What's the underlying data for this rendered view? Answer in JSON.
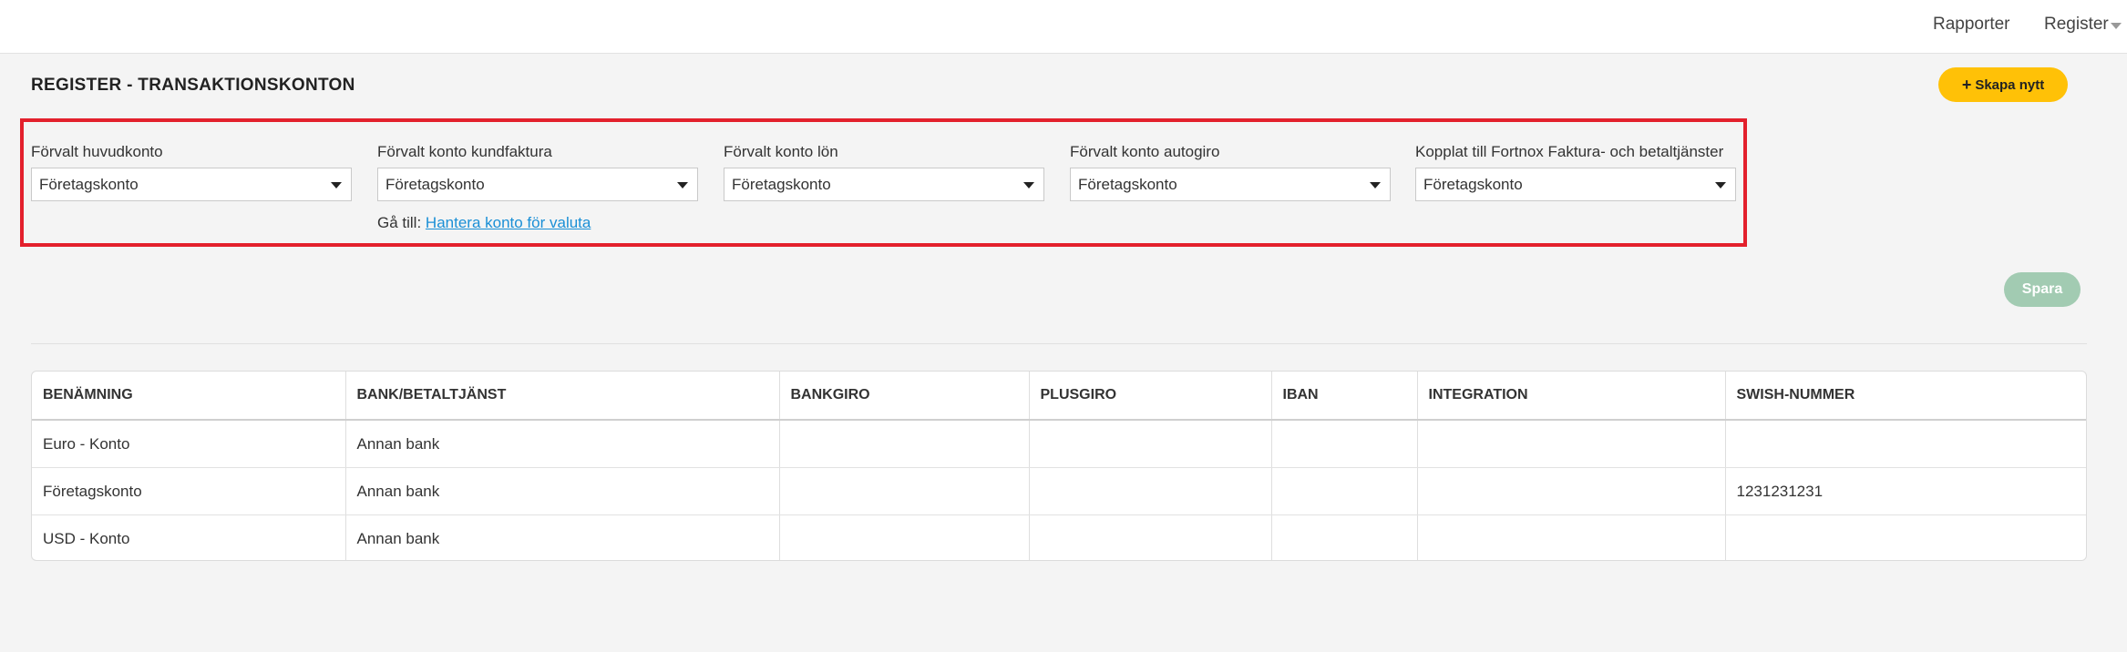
{
  "nav": {
    "reports": "Rapporter",
    "register": "Register"
  },
  "page": {
    "title": "REGISTER - TRANSAKTIONSKONTON",
    "create_button": "Skapa nytt",
    "save_button": "Spara"
  },
  "defaults": [
    {
      "label": "Förvalt huvudkonto",
      "value": "Företagskonto"
    },
    {
      "label": "Förvalt konto kundfaktura",
      "value": "Företagskonto"
    },
    {
      "label": "Förvalt konto lön",
      "value": "Företagskonto"
    },
    {
      "label": "Förvalt konto autogiro",
      "value": "Företagskonto"
    },
    {
      "label": "Kopplat till Fortnox Faktura- och betaltjänster",
      "value": "Företagskonto"
    }
  ],
  "goto": {
    "prefix": "Gå till:",
    "link": "Hantera konto för valuta"
  },
  "table": {
    "columns": [
      "BENÄMNING",
      "BANK/BETALTJÄNST",
      "BANKGIRO",
      "PLUSGIRO",
      "IBAN",
      "INTEGRATION",
      "SWISH-NUMMER"
    ],
    "rows": [
      [
        "Euro - Konto",
        "Annan bank",
        "",
        "",
        "",
        "",
        ""
      ],
      [
        "Företagskonto",
        "Annan bank",
        "",
        "",
        "",
        "",
        "1231231231"
      ],
      [
        "USD - Konto",
        "Annan bank",
        "",
        "",
        "",
        "",
        ""
      ]
    ]
  },
  "colors": {
    "accent": "#ffc107",
    "save_disabled": "#a2cbb2",
    "highlight": "#e3202c",
    "link": "#1a8fd6"
  }
}
